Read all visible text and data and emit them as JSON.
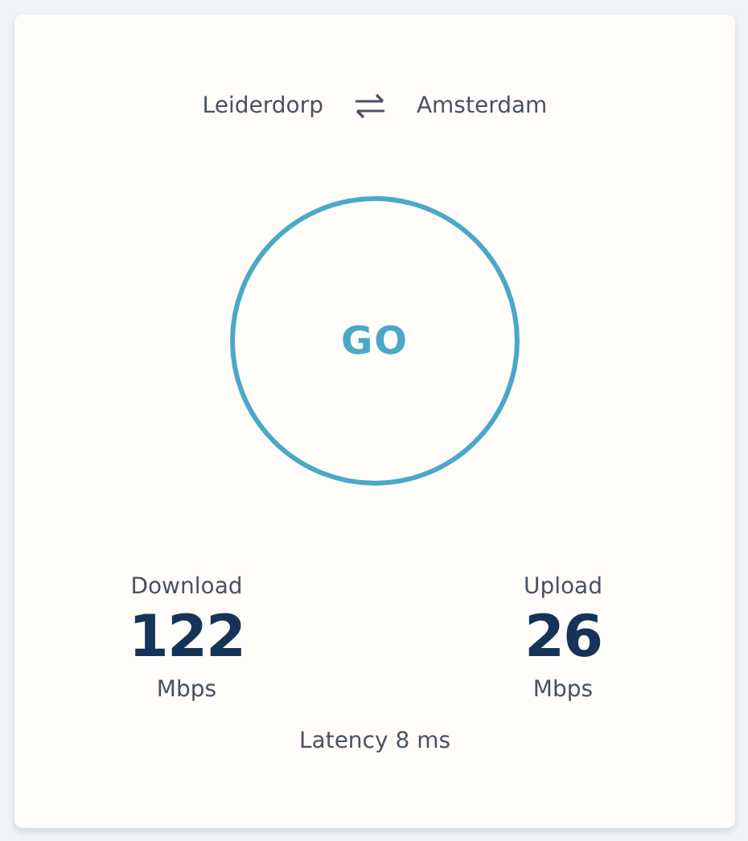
{
  "route": {
    "from": "Leiderdorp",
    "to": "Amsterdam"
  },
  "go_button": {
    "label": "GO"
  },
  "stats": [
    {
      "label": "Download",
      "value": "122",
      "unit": "Mbps"
    },
    {
      "label": "Upload",
      "value": "26",
      "unit": "Mbps"
    }
  ],
  "latency": "Latency 8 ms"
}
